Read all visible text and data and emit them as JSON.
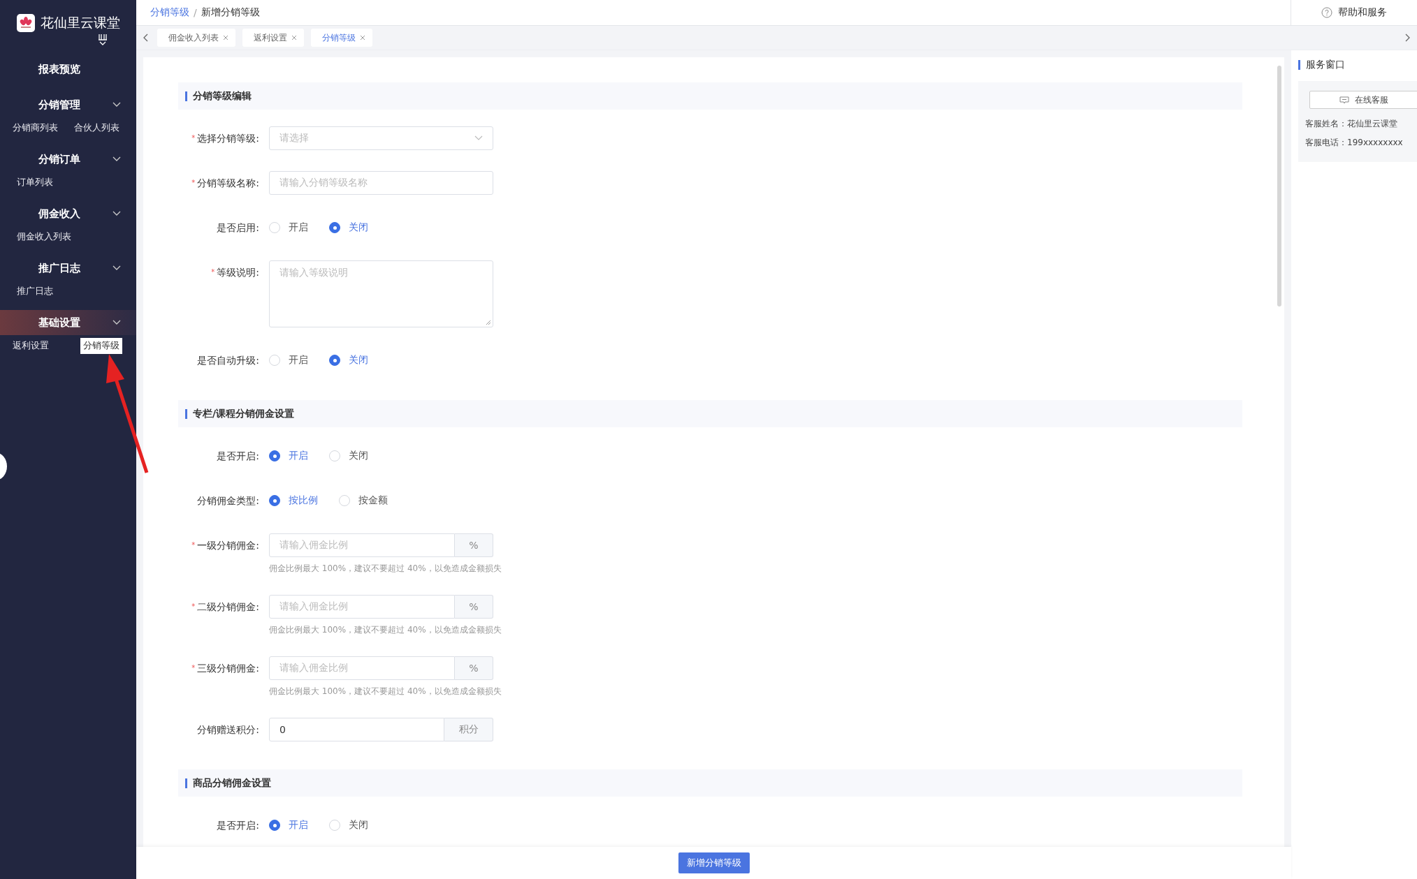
{
  "sidebar": {
    "brand": "花仙里云课堂",
    "groups": [
      {
        "title": "报表预览",
        "selected": false
      },
      {
        "title": "分销管理",
        "selected": false,
        "items": [
          {
            "label": "分销商列表",
            "selected": false
          },
          {
            "label": "合伙人列表",
            "selected": false
          }
        ]
      },
      {
        "title": "分销订单",
        "selected": false,
        "items": [
          {
            "label": "订单列表",
            "selected": false
          }
        ]
      },
      {
        "title": "佣金收入",
        "selected": false,
        "items": [
          {
            "label": "佣金收入列表",
            "selected": false
          }
        ]
      },
      {
        "title": "推广日志",
        "selected": false,
        "items": [
          {
            "label": "推广日志",
            "selected": false
          }
        ]
      },
      {
        "title": "基础设置",
        "selected": true,
        "items": [
          {
            "label": "返利设置",
            "selected": false
          },
          {
            "label": "分销等级",
            "selected": true
          }
        ]
      }
    ]
  },
  "breadcrumb": [
    {
      "label": "分销等级",
      "kind": "link"
    },
    {
      "label": "/",
      "kind": "separator"
    },
    {
      "label": "新增分销等级",
      "kind": "current"
    }
  ],
  "help": "帮助和服务",
  "tabs": [
    {
      "label": "佣金收入列表",
      "selected": false
    },
    {
      "label": "返利设置",
      "selected": false
    },
    {
      "label": "分销等级",
      "selected": true
    }
  ],
  "sections": [
    {
      "title": "分销等级编辑",
      "fields": [
        {
          "kind": "select",
          "label": "选择分销等级:",
          "required_mark": "*",
          "placeholder": "请选择"
        },
        {
          "kind": "input",
          "label": "分销等级名称:",
          "required_mark": "*",
          "placeholder": "请输入分销等级名称"
        },
        {
          "kind": "radio",
          "label": "是否启用:",
          "options": [
            {
              "label": "开启",
              "selected": false
            },
            {
              "label": "关闭",
              "selected": true
            }
          ]
        },
        {
          "kind": "textarea",
          "label": "等级说明:",
          "required_mark": "*",
          "placeholder": "请输入等级说明"
        },
        {
          "kind": "radio",
          "label": "是否自动升级:",
          "options": [
            {
              "label": "开启",
              "selected": false
            },
            {
              "label": "关闭",
              "selected": true
            }
          ]
        }
      ]
    },
    {
      "title": "专栏/课程分销佣金设置",
      "fields": [
        {
          "kind": "radio",
          "label": "是否开启:",
          "options": [
            {
              "label": "开启",
              "selected": true
            },
            {
              "label": "关闭",
              "selected": false
            }
          ]
        },
        {
          "kind": "radio",
          "label": "分销佣金类型:",
          "options": [
            {
              "label": "按比例",
              "selected": true
            },
            {
              "label": "按金额",
              "selected": false
            }
          ]
        },
        {
          "kind": "addon",
          "label": "一级分销佣金:",
          "required_mark": "*",
          "placeholder": "请输入佣金比例",
          "addon": "%",
          "hint": "佣金比例最大 100%，建议不要超过 40%，以免造成金额损失"
        },
        {
          "kind": "addon",
          "label": "二级分销佣金:",
          "required_mark": "*",
          "placeholder": "请输入佣金比例",
          "addon": "%",
          "hint": "佣金比例最大 100%，建议不要超过 40%，以免造成金额损失"
        },
        {
          "kind": "addon",
          "label": "三级分销佣金:",
          "required_mark": "*",
          "placeholder": "请输入佣金比例",
          "addon": "%",
          "hint": "佣金比例最大 100%，建议不要超过 40%，以免造成金额损失"
        },
        {
          "kind": "addon",
          "label": "分销赠送积分:",
          "value": "0",
          "addon": "积分"
        }
      ]
    },
    {
      "title": "商品分销佣金设置",
      "fields": [
        {
          "kind": "radio",
          "label": "是否开启:",
          "options": [
            {
              "label": "开启",
              "selected": true
            },
            {
              "label": "关闭",
              "selected": false
            }
          ]
        }
      ]
    }
  ],
  "submit": "新增分销等级",
  "service": {
    "title": "服务窗口",
    "button": "在线客服",
    "lines": [
      "客服姓名：花仙里云课堂",
      "客服电话：199xxxxxxxx"
    ]
  }
}
